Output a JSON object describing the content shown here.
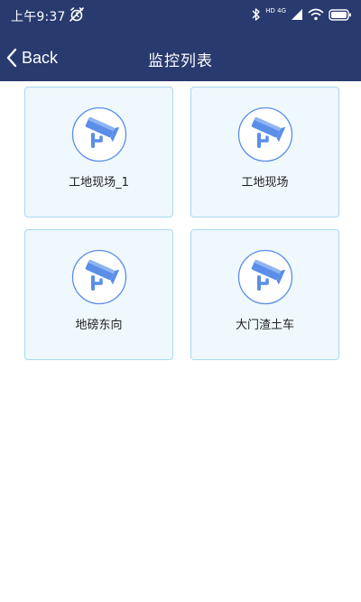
{
  "status_bar": {
    "time": "上午9:37",
    "network": "HD 4G"
  },
  "nav": {
    "back_label": "Back",
    "title": "监控列表"
  },
  "cameras": [
    {
      "name": "工地现场_1"
    },
    {
      "name": "工地现场"
    },
    {
      "name": "地磅东向"
    },
    {
      "name": "大门渣土车"
    }
  ],
  "colors": {
    "header_bg": "#283a6e",
    "card_bg": "#eef8fd",
    "card_border": "#a9d8f0",
    "icon_blue": "#5b8ee8"
  }
}
